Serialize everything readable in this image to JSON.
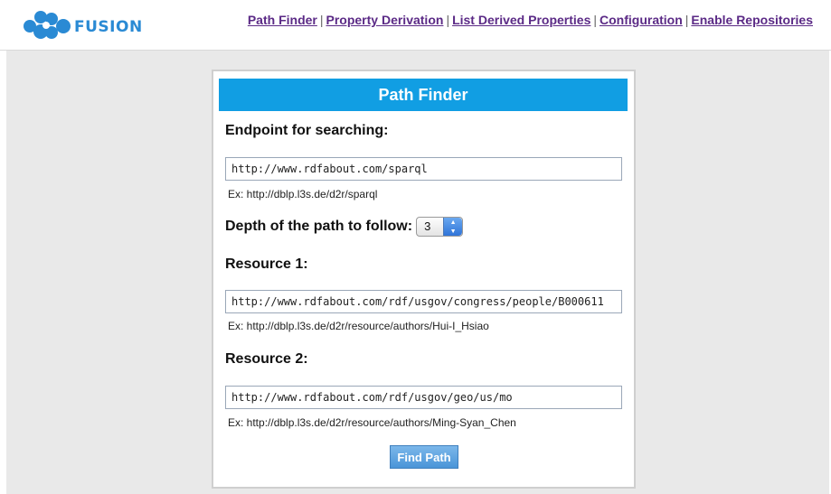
{
  "brand": {
    "name": "FUSION"
  },
  "nav": {
    "items": [
      "Path Finder",
      "Property Derivation",
      "List Derived Properties",
      "Configuration",
      "Enable Repositories"
    ],
    "separator": "|"
  },
  "panel": {
    "title": "Path Finder",
    "endpoint": {
      "label": "Endpoint for searching:",
      "value": "http://www.rdfabout.com/sparql",
      "hint": "Ex: http://dblp.l3s.de/d2r/sparql"
    },
    "depth": {
      "label": "Depth of the path to follow:",
      "value": "3"
    },
    "resource1": {
      "label": "Resource 1:",
      "value": "http://www.rdfabout.com/rdf/usgov/congress/people/B000611",
      "hint": "Ex: http://dblp.l3s.de/d2r/resource/authors/Hui-I_Hsiao"
    },
    "resource2": {
      "label": "Resource 2:",
      "value": "http://www.rdfabout.com/rdf/usgov/geo/us/mo",
      "hint": "Ex: http://dblp.l3s.de/d2r/resource/authors/Ming-Syan_Chen"
    },
    "submit_label": "Find Path"
  },
  "colors": {
    "title_bar": "#119ee3",
    "nav_link": "#5b2a86",
    "brand": "#2a8ad4",
    "button": "#4a95d8",
    "background": "#e9e9e9"
  }
}
